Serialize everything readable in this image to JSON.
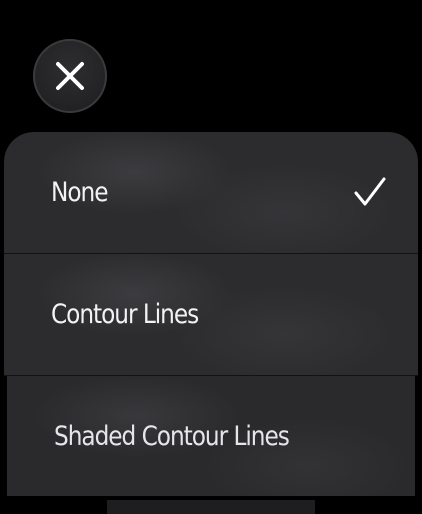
{
  "close_button": {
    "icon": "close-icon",
    "color": "#ffffff"
  },
  "menu": {
    "items": [
      {
        "label": "None",
        "selected": true,
        "check_icon": "checkmark-icon"
      },
      {
        "label": "Contour Lines",
        "selected": false
      },
      {
        "label": "Shaded Contour Lines",
        "selected": false
      }
    ]
  },
  "colors": {
    "background": "#000000",
    "item_background": "#2c2c2e",
    "text": "#f2f2f5"
  }
}
